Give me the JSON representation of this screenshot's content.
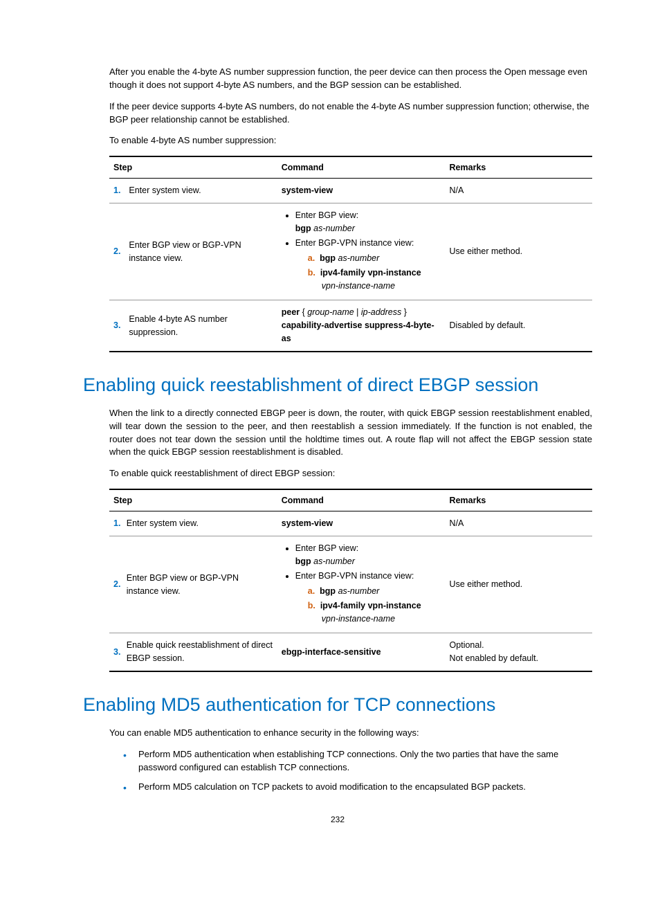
{
  "intro": {
    "p1": "After you enable the 4-byte AS number suppression function, the peer device can then process the Open message even though it does not support 4-byte AS numbers, and the BGP session can be established.",
    "p2": "If the peer device supports 4-byte AS numbers, do not enable the 4-byte AS number suppression function; otherwise, the BGP peer relationship cannot be established.",
    "p3": "To enable 4-byte AS number suppression:"
  },
  "table_headers": {
    "step": "Step",
    "command": "Command",
    "remarks": "Remarks"
  },
  "t1": {
    "r1": {
      "num": "1.",
      "step": "Enter system view.",
      "cmd": "system-view",
      "rem": "N/A"
    },
    "r2": {
      "num": "2.",
      "step": "Enter BGP view or BGP-VPN instance view.",
      "b1": "Enter BGP view:",
      "b1_cmd": "bgp",
      "b1_arg": "as-number",
      "b2": "Enter BGP-VPN instance view:",
      "a_lbl": "a.",
      "a_cmd": "bgp",
      "a_arg": "as-number",
      "b_lbl": "b.",
      "b_cmd": "ipv4-family vpn-instance",
      "b_arg": "vpn-instance-name",
      "rem": "Use either method."
    },
    "r3": {
      "num": "3.",
      "step": "Enable 4-byte AS number suppression.",
      "c1": "peer",
      "c2": "group-name",
      "c3": "ip-address",
      "c4": "capability-advertise suppress-4-byte-as",
      "rem": "Disabled by default."
    }
  },
  "sec1": {
    "heading": "Enabling quick reestablishment of direct EBGP session",
    "p1": "When the link to a directly connected EBGP peer is down, the router, with quick EBGP session reestablishment enabled, will tear down the session to the peer, and then reestablish a session immediately. If the function is not enabled, the router does not tear down the session until the holdtime times out. A route flap will not affect the EBGP session state when the quick EBGP session reestablishment is disabled.",
    "p2": "To enable quick reestablishment of direct EBGP session:"
  },
  "t2": {
    "r1": {
      "num": "1.",
      "step": "Enter system view.",
      "cmd": "system-view",
      "rem": "N/A"
    },
    "r2": {
      "num": "2.",
      "step": "Enter BGP view or BGP-VPN instance view.",
      "b1": "Enter BGP view:",
      "b1_cmd": "bgp",
      "b1_arg": "as-number",
      "b2": "Enter BGP-VPN instance view:",
      "a_lbl": "a.",
      "a_cmd": "bgp",
      "a_arg": "as-number",
      "b_lbl": "b.",
      "b_cmd": "ipv4-family vpn-instance",
      "b_arg": "vpn-instance-name",
      "rem": "Use either method."
    },
    "r3": {
      "num": "3.",
      "step": "Enable quick reestablishment of direct EBGP session.",
      "cmd": "ebgp-interface-sensitive",
      "rem1": "Optional.",
      "rem2": "Not enabled by default."
    }
  },
  "sec2": {
    "heading": "Enabling MD5 authentication for TCP connections",
    "p1": "You can enable MD5 authentication to enhance security in the following ways:",
    "li1": "Perform MD5 authentication when establishing TCP connections. Only the two parties that have the same password configured can establish TCP connections.",
    "li2": "Perform MD5 calculation on TCP packets to avoid modification to the encapsulated BGP packets."
  },
  "page_number": "232"
}
